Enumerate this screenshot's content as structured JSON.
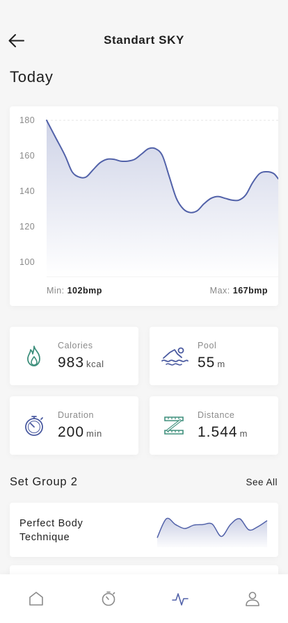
{
  "header": {
    "title": "Standart SKY",
    "back_icon": "arrow-left-icon"
  },
  "today_label": "Today",
  "chart_data": {
    "type": "area",
    "y_ticks": [
      "180",
      "160",
      "140",
      "120",
      "100"
    ],
    "ylim": [
      100,
      180
    ],
    "x": [
      0,
      4,
      8,
      11,
      14,
      17,
      20,
      23,
      26,
      29,
      32,
      35,
      38,
      41,
      44,
      47,
      50,
      53,
      56,
      59,
      62,
      65,
      68,
      71,
      74,
      77,
      80,
      83,
      86,
      89,
      92,
      95,
      98,
      100
    ],
    "values": [
      180,
      170,
      160,
      151,
      148,
      148,
      152,
      156,
      158,
      158,
      157,
      157,
      158,
      161,
      164,
      164,
      160,
      148,
      136,
      130,
      128,
      129,
      133,
      136,
      137,
      136,
      135,
      135,
      138,
      145,
      150,
      151,
      150,
      147
    ],
    "min_label": "Min:",
    "min_value": "102bmp",
    "max_label": "Max:",
    "max_value": "167bmp",
    "color": "#5262a9"
  },
  "stats": [
    {
      "label": "Calories",
      "value": "983",
      "unit": "kcal",
      "icon": "flame-icon"
    },
    {
      "label": "Pool",
      "value": "55",
      "unit": "m",
      "icon": "swimmer-icon"
    },
    {
      "label": "Duration",
      "value": "200",
      "unit": "min",
      "icon": "stopwatch-icon"
    },
    {
      "label": "Distance",
      "value": "1.544",
      "unit": "m",
      "icon": "ruler-icon"
    }
  ],
  "section": {
    "title": "Set Group 2",
    "see_all": "See All"
  },
  "groups": [
    {
      "name": "Perfect Body Technique",
      "sparkline": [
        20,
        92,
        70,
        55,
        68,
        70,
        72,
        25,
        70,
        92,
        50,
        62,
        85
      ]
    }
  ],
  "tabs": [
    {
      "icon": "home-icon",
      "active": false
    },
    {
      "icon": "timer-icon",
      "active": false
    },
    {
      "icon": "activity-icon",
      "active": true
    },
    {
      "icon": "profile-icon",
      "active": false
    }
  ],
  "colors": {
    "accent": "#5262a9",
    "icon_green": "#3e8f7c",
    "icon_blue": "#4a5aa0",
    "tab_inactive": "#8a8a8a"
  }
}
